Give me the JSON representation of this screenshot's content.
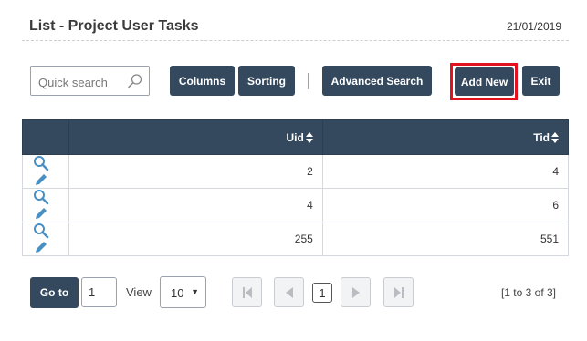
{
  "header": {
    "title": "List - Project User Tasks",
    "date": "21/01/2019"
  },
  "toolbar": {
    "search_placeholder": "Quick search",
    "columns_label": "Columns",
    "sorting_label": "Sorting",
    "advanced_search_label": "Advanced Search",
    "add_new_label": "Add New",
    "exit_label": "Exit",
    "highlight_color": "#e3121f"
  },
  "table": {
    "columns": [
      "Uid",
      "Tid"
    ],
    "rows": [
      {
        "uid": "2",
        "tid": "4"
      },
      {
        "uid": "4",
        "tid": "6"
      },
      {
        "uid": "255",
        "tid": "551"
      }
    ],
    "row_icons": [
      "search-icon",
      "edit-icon"
    ]
  },
  "footer": {
    "goto_label": "Go to",
    "page_value": "1",
    "view_label": "View",
    "view_value": "10",
    "current_page": "1",
    "info": "[1 to 3 of 3]"
  },
  "colors": {
    "primary": "#34495e",
    "icon": "#4a8fc2"
  }
}
